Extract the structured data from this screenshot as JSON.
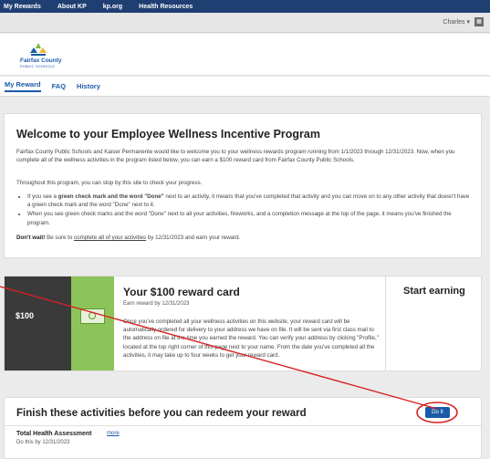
{
  "topnav": {
    "items": [
      "My Rewards",
      "About KP",
      "kp.org",
      "Health Resources"
    ]
  },
  "user": {
    "name": "Charles ▾",
    "badge": "▦"
  },
  "logo": {
    "line1": "Fairfax County",
    "line2": "PUBLIC SCHOOLS"
  },
  "tabs": [
    "My Reward",
    "FAQ",
    "History"
  ],
  "welcome": {
    "title": "Welcome to your Employee Wellness Incentive Program",
    "intro": "Fairfax County Public Schools and Kaiser Permanente would like to welcome you to your wellness rewards program running from 1/1/2023 through 12/31/2023. Now, when you complete all of the wellness activities in the program listed below, you can earn a $100 reward card from Fairfax County Public Schools.",
    "throughout": "Throughout this program, you can stop by this site to check your progress.",
    "bullet1_pre": "If you see a ",
    "bullet1_bold": "green check mark and the word \"Done\"",
    "bullet1_post": " next to an activity, it means that you've completed that activity and you can move on to any other activity that doesn't have a green check mark and the word \"Done\" next to it.",
    "bullet2": "When you see green check marks and the word \"Done\" next to all your activities, fireworks, and a completion message at the top of the page, it means you've finished the program.",
    "dont_wait_bold": "Don't wait!",
    "dont_wait_mid": " Be sure to ",
    "dont_wait_link": "complete all of your activities",
    "dont_wait_end": " by 12/31/2023 and earn your reward."
  },
  "reward": {
    "amount": "$100",
    "title": "Your $100 reward card",
    "earn_by": "Earn reward by 12/31/2023",
    "description": "Once you've completed all your wellness activities on this website, your reward card will be automatically ordered for delivery to your address we have on file. It will be sent via first class mail to the address on file at the time you earned the reward. You can verify your address by clicking \"Profile,\" located at the top right corner of this page next to your name. From the date you've completed all the activities, it may take up to four weeks to get your reward card.",
    "start": "Start earning"
  },
  "finish": {
    "title": "Finish these activities before you can redeem your reward",
    "activity": "Total Health Assessment",
    "more": "more",
    "due": "Do this by 12/31/2023",
    "button": "Do It"
  },
  "colors": {
    "nav": "#1f3f73",
    "accent": "#1b5aa8",
    "cash": "#8dc45a",
    "annotation": "#d62020"
  }
}
